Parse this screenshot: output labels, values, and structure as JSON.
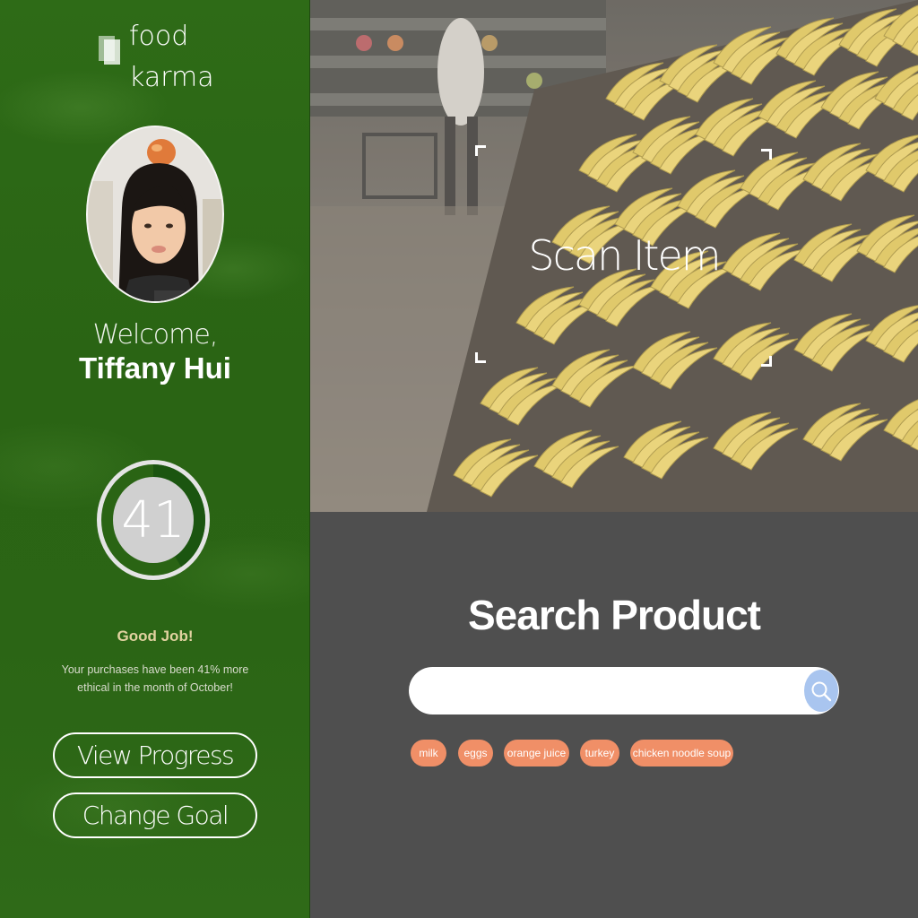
{
  "brand": {
    "line1": "food",
    "line2": "karma"
  },
  "user": {
    "welcome": "Welcome,",
    "name": "Tiffany Hui"
  },
  "score": {
    "value": "41",
    "fraction": 0.41,
    "message": "Good Job!",
    "summary": "Your purchases have been 41% more ethical in the month of October!"
  },
  "actions": {
    "view_progress": "View Progress",
    "change_goal": "Change Goal"
  },
  "scan": {
    "label": "Scan Item"
  },
  "search": {
    "title": "Search Product",
    "placeholder": "",
    "value": "",
    "suggestions": [
      "milk",
      "eggs",
      "orange juice",
      "turkey",
      "chicken noodle soup"
    ]
  },
  "colors": {
    "sidebar_green": "#2b6515",
    "score_ring_dark": "#1e5a0f",
    "score_ring_light": "#d0d0d0",
    "chip": "#f08f67",
    "search_button": "#a9c5ef",
    "panel_gray": "#4f4f4f"
  }
}
